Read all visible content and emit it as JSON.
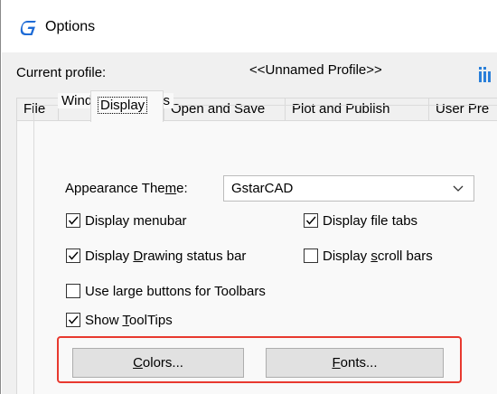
{
  "window": {
    "title": "Options",
    "app_icon": "gstarcad-g-icon"
  },
  "profile": {
    "label": "Current profile:",
    "value": "<<Unnamed Profile>>",
    "icon": "profile-drawing-icon"
  },
  "tabs": [
    {
      "label": "File",
      "active": false
    },
    {
      "label": "Display",
      "active": true
    },
    {
      "label": "Open and Save",
      "active": false
    },
    {
      "label": "Plot and Publish",
      "active": false
    },
    {
      "label": "User Pre",
      "active": false
    }
  ],
  "window_elements": {
    "group_label": "Window Elements",
    "appearance_theme": {
      "label_pre": "Appearance The",
      "label_mnemonic": "m",
      "label_post": "e:",
      "value": "GstarCAD"
    },
    "checkboxes": {
      "display_menubar": {
        "label": "Display menubar",
        "checked": true
      },
      "display_file_tabs": {
        "label": "Display file tabs",
        "checked": true
      },
      "display_drawing_status_bar": {
        "pre": "Display ",
        "mnemonic": "D",
        "post": "rawing status bar",
        "checked": true
      },
      "display_scroll_bars": {
        "pre": "Display ",
        "mnemonic": "s",
        "post": "croll bars",
        "checked": false
      },
      "use_large_buttons": {
        "label": "Use large buttons for Toolbars",
        "checked": false
      },
      "show_tooltips": {
        "pre": "Show ",
        "mnemonic": "T",
        "post": "oolTips",
        "checked": true
      }
    },
    "buttons": {
      "colors": {
        "mnemonic": "C",
        "rest": "olors..."
      },
      "fonts": {
        "mnemonic": "F",
        "rest": "onts..."
      }
    }
  },
  "colors": {
    "highlight": "#e8392f",
    "app_icon_blue": "#1e6bd6",
    "panel_background": "#f9f9f9",
    "client_background": "#f0f0f0"
  }
}
